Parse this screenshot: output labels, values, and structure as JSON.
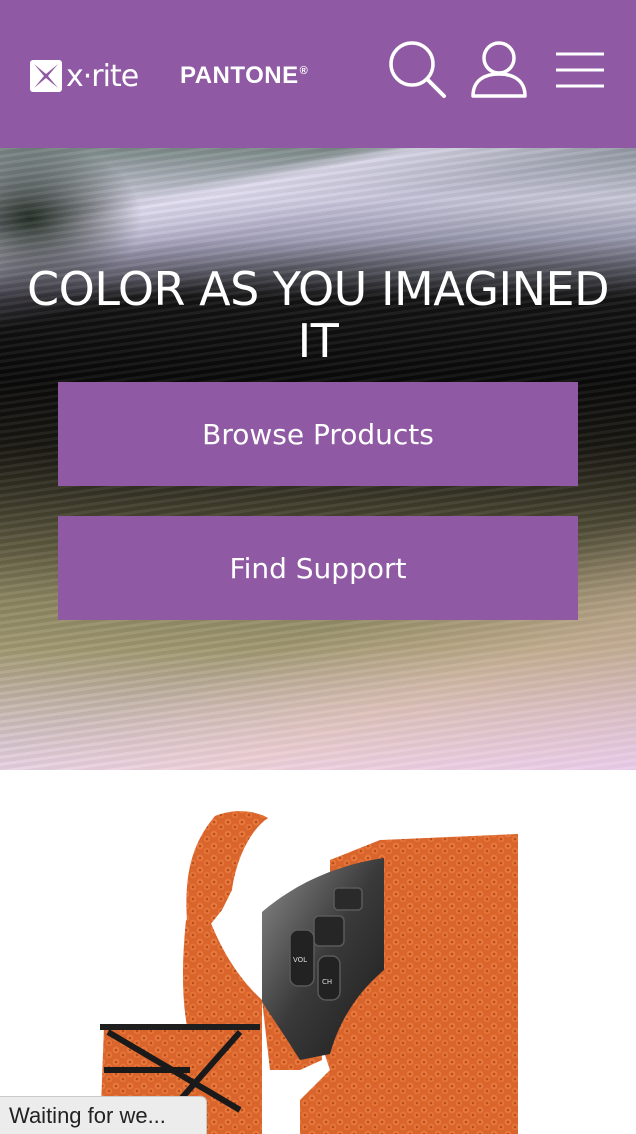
{
  "header": {
    "logo_xrite": "x·rite",
    "logo_pantone": "PANTONE",
    "logo_pantone_mark": "®",
    "icons": [
      "search-icon",
      "user-icon",
      "menu-icon"
    ],
    "color": "#8f5aa3"
  },
  "hero": {
    "title": "COLOR AS YOU IMAGINED IT",
    "browse_label": "Browse Products",
    "support_label": "Find Support",
    "button_color": "#8f5aa3"
  },
  "product": {
    "image": "steering-wheel-leather-image",
    "control_labels": [
      "VOL",
      "CH"
    ]
  },
  "status": {
    "text": "Waiting for we..."
  }
}
